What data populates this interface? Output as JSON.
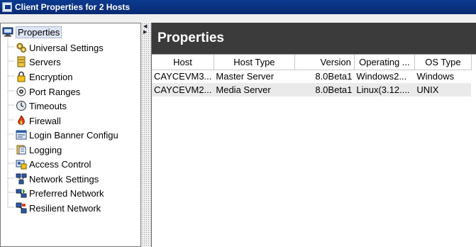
{
  "window": {
    "title": "Client Properties for 2 Hosts"
  },
  "tree": {
    "root": {
      "label": "Properties",
      "icon": "computer-icon"
    },
    "items": [
      {
        "label": "Universal Settings",
        "icon": "settings-icon"
      },
      {
        "label": "Servers",
        "icon": "server-icon"
      },
      {
        "label": "Encryption",
        "icon": "lock-icon"
      },
      {
        "label": "Port Ranges",
        "icon": "port-icon"
      },
      {
        "label": "Timeouts",
        "icon": "clock-icon"
      },
      {
        "label": "Firewall",
        "icon": "firewall-icon"
      },
      {
        "label": "Login Banner Configu",
        "icon": "banner-icon"
      },
      {
        "label": "Logging",
        "icon": "log-icon"
      },
      {
        "label": "Access Control",
        "icon": "access-control-icon"
      },
      {
        "label": "Network Settings",
        "icon": "network-settings-icon"
      },
      {
        "label": "Preferred Network",
        "icon": "preferred-network-icon"
      },
      {
        "label": "Resilient Network",
        "icon": "resilient-network-icon"
      }
    ]
  },
  "panel": {
    "title": "Properties",
    "table": {
      "columns": [
        "Host",
        "Host Type",
        "Version",
        "Operating ...",
        "OS Type"
      ],
      "rows": [
        [
          "CAYCEVM3...",
          "Master Server",
          "8.0Beta1",
          "Windows2...",
          "Windows"
        ],
        [
          "CAYCEVM2...",
          "Media Server",
          "8.0Beta1",
          "Linux(3.12....",
          "UNIX"
        ]
      ]
    }
  }
}
